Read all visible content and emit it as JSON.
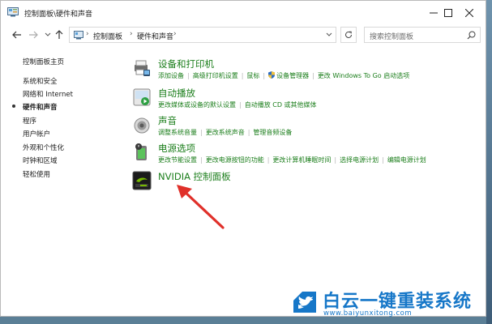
{
  "window": {
    "title": "控制面板\\硬件和声音"
  },
  "nav": {
    "breadcrumb": [
      "控制面板",
      "硬件和声音"
    ],
    "search_placeholder": "搜索控制面板"
  },
  "sidebar": {
    "items": [
      {
        "label": "控制面板主页",
        "current": false
      },
      {
        "label": "系统和安全",
        "current": false
      },
      {
        "label": "网络和 Internet",
        "current": false
      },
      {
        "label": "硬件和声音",
        "current": true
      },
      {
        "label": "程序",
        "current": false
      },
      {
        "label": "用户帐户",
        "current": false
      },
      {
        "label": "外观和个性化",
        "current": false
      },
      {
        "label": "时钟和区域",
        "current": false
      },
      {
        "label": "轻松使用",
        "current": false
      }
    ]
  },
  "categories": [
    {
      "title": "设备和打印机",
      "icon": "printer-icon",
      "links": [
        "添加设备",
        "高级打印机设置",
        "鼠标",
        "设备管理器",
        "更改 Windows To Go 启动选项"
      ]
    },
    {
      "title": "自动播放",
      "icon": "autoplay-icon",
      "links": [
        "更改媒体或设备的默认设置",
        "自动播放 CD 或其他媒体"
      ]
    },
    {
      "title": "声音",
      "icon": "speaker-icon",
      "links": [
        "调整系统音量",
        "更改系统声音",
        "管理音频设备"
      ]
    },
    {
      "title": "电源选项",
      "icon": "power-options-icon",
      "links": [
        "更改节能设置",
        "更改电源按钮的功能",
        "更改计算机睡眠时间",
        "选择电源计划",
        "编辑电源计划"
      ]
    },
    {
      "title": "NVIDIA 控制面板",
      "icon": "nvidia-icon",
      "links": []
    }
  ],
  "watermark": {
    "text": "白云一键重装系统",
    "url": "www.baiyunxitong.com"
  },
  "colors": {
    "link_green": "#1b7e1b",
    "arrow_red": "#e0302a",
    "watermark_blue": "#1677c8"
  }
}
